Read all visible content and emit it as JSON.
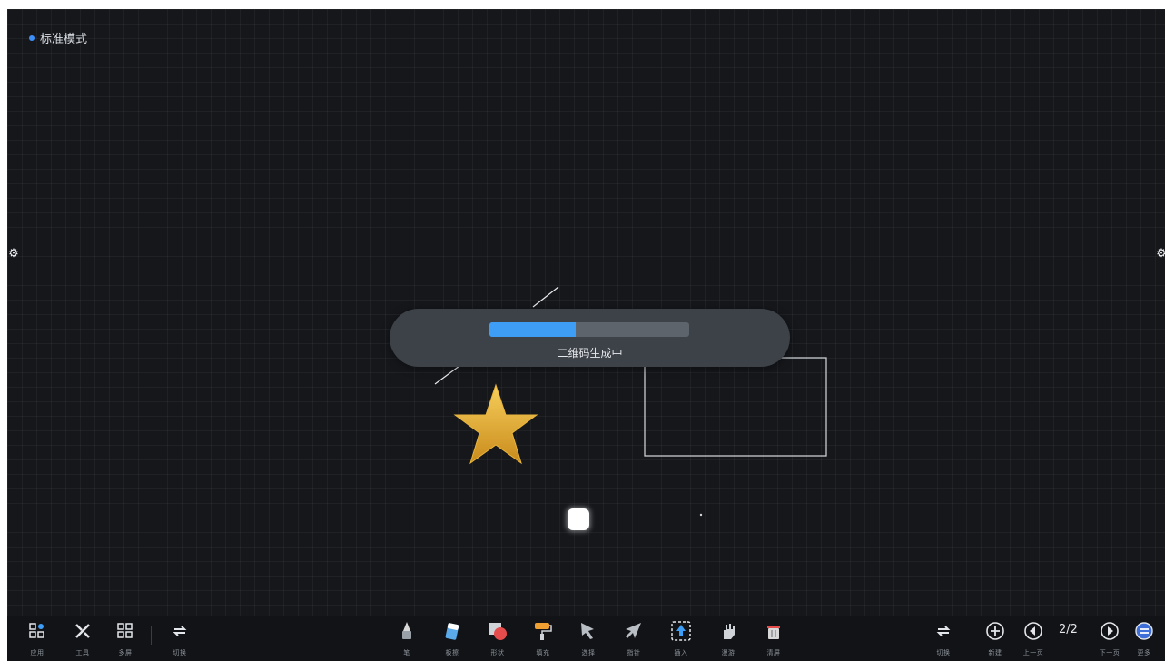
{
  "mode_indicator": {
    "label": "标准模式"
  },
  "progress_toast": {
    "text": "二维码生成中",
    "progress": 0.43
  },
  "toolbar": {
    "left": [
      {
        "name": "apps-button",
        "icon": "apps-grid-icon",
        "label": "应用"
      },
      {
        "name": "tools-button",
        "icon": "tools-icon",
        "label": "工具"
      },
      {
        "name": "layout-button",
        "icon": "grid-icon",
        "label": "多屏"
      },
      {
        "name": "switch-button",
        "icon": "swap-icon",
        "label": "切换"
      }
    ],
    "center": [
      {
        "name": "pen-tool",
        "icon": "pen-icon",
        "label": "笔"
      },
      {
        "name": "eraser-tool",
        "icon": "eraser-icon",
        "label": "板擦"
      },
      {
        "name": "shape-tool",
        "icon": "shape-icon",
        "label": "形状"
      },
      {
        "name": "fill-tool",
        "icon": "paint-roller-icon",
        "label": "填充"
      },
      {
        "name": "select-tool",
        "icon": "cursor-icon",
        "label": "选择"
      },
      {
        "name": "pointer-tool",
        "icon": "arrow-pointer-icon",
        "label": "指针"
      },
      {
        "name": "insert-tool",
        "icon": "insert-image-icon",
        "label": "插入"
      },
      {
        "name": "roam-tool",
        "icon": "hand-icon",
        "label": "漫游"
      },
      {
        "name": "clear-tool",
        "icon": "trash-icon",
        "label": "清屏"
      }
    ],
    "right": [
      {
        "name": "switch-button-right",
        "icon": "swap-icon",
        "label": "切换"
      },
      {
        "name": "new-page-button",
        "icon": "plus-circle-icon",
        "label": "新建"
      },
      {
        "name": "prev-page-button",
        "icon": "prev-circle-icon",
        "label": "上一页"
      },
      {
        "name": "next-page-button",
        "icon": "next-circle-icon",
        "label": "下一页"
      },
      {
        "name": "more-button",
        "icon": "menu-circle-icon",
        "label": "更多"
      }
    ],
    "page_counter": "2/2"
  },
  "colors": {
    "accent": "#3e9ef5",
    "board": "#15171b",
    "toast": "#3d4249"
  }
}
